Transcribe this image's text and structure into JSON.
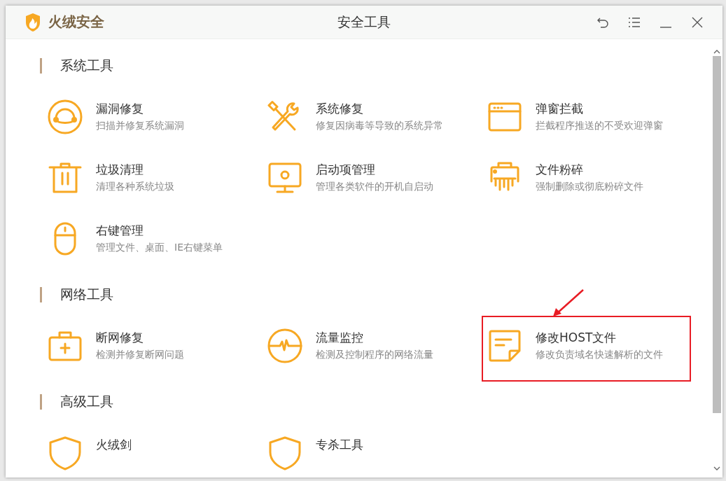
{
  "window": {
    "brand": "火绒安全",
    "title": "安全工具"
  },
  "sections": [
    {
      "title": "系统工具",
      "items": [
        {
          "kind": "headset",
          "title": "漏洞修复",
          "description": "扫描并修复系统漏洞",
          "highlighted": false
        },
        {
          "kind": "tools",
          "title": "系统修复",
          "description": "修复因病毒等导致的系统异常",
          "highlighted": false
        },
        {
          "kind": "popup",
          "title": "弹窗拦截",
          "description": "拦截程序推送的不受欢迎弹窗",
          "highlighted": false
        },
        {
          "kind": "trash",
          "title": "垃圾清理",
          "description": "清理各种系统垃圾",
          "highlighted": false
        },
        {
          "kind": "monitor",
          "title": "启动项管理",
          "description": "管理各类软件的开机自启动",
          "highlighted": false
        },
        {
          "kind": "shredder",
          "title": "文件粉碎",
          "description": "强制删除或彻底粉碎文件",
          "highlighted": false
        },
        {
          "kind": "mouse",
          "title": "右键管理",
          "description": "管理文件、桌面、IE右键菜单",
          "highlighted": false
        }
      ]
    },
    {
      "title": "网络工具",
      "items": [
        {
          "kind": "kit",
          "title": "断网修复",
          "description": "检测并修复断网问题",
          "highlighted": false
        },
        {
          "kind": "pulse",
          "title": "流量监控",
          "description": "检测及控制程序的网络流量",
          "highlighted": false
        },
        {
          "kind": "note",
          "title": "修改HOST文件",
          "description": "修改负责域名快速解析的文件",
          "highlighted": true
        }
      ]
    },
    {
      "title": "高级工具",
      "items": [
        {
          "kind": "shield",
          "title": "火绒剑",
          "highlighted": false
        },
        {
          "kind": "shield",
          "title": "专杀工具",
          "highlighted": false
        }
      ]
    }
  ]
}
